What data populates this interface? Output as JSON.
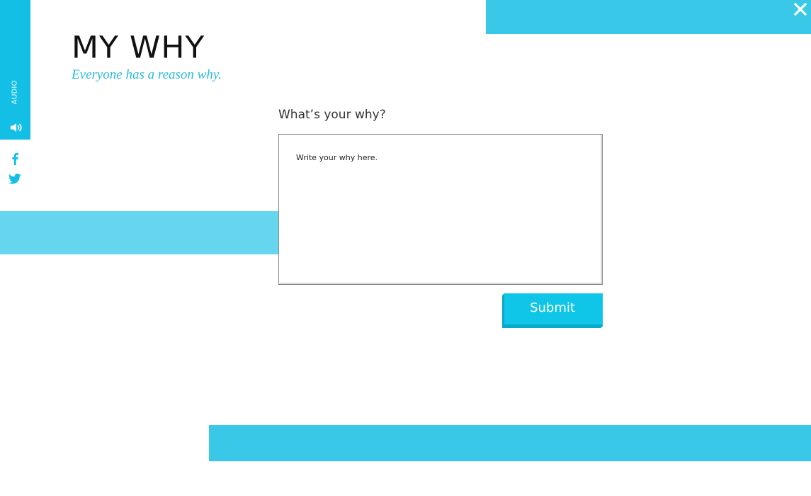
{
  "header": {
    "title": "MY WHY",
    "subtitle": "Everyone has a reason why."
  },
  "sidebar": {
    "audio_label": "AUDIO",
    "icons": [
      "speaker-icon",
      "facebook-icon",
      "twitter-icon"
    ]
  },
  "form": {
    "prompt": "What’s your why?",
    "input_placeholder": "Write your why here.",
    "input_value": "",
    "submit_label": "Submit"
  },
  "window": {
    "close_icon": "close-icon"
  },
  "colors": {
    "accent": "#14bfe6",
    "bar": "#39c8e8",
    "bar_light": "#66d6ee",
    "subtitle": "#29b8df",
    "button": "#10c6e8"
  }
}
